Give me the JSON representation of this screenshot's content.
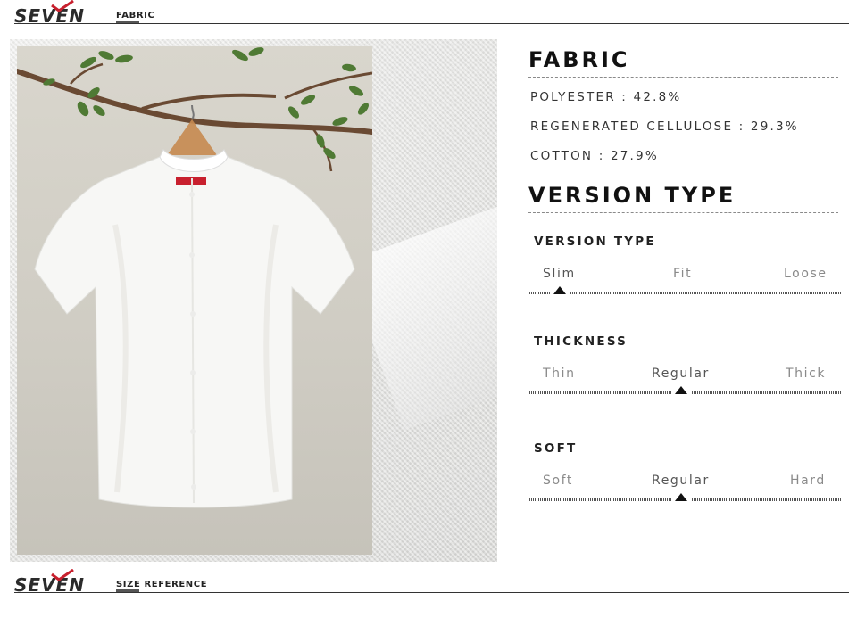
{
  "header": {
    "brand": "SEVEN",
    "label": "FABRIC"
  },
  "footer": {
    "brand": "SEVEN",
    "label": "SIZE REFERENCE"
  },
  "colors": {
    "brand_accent": "#c8202e",
    "text": "#111111",
    "muted": "#8a8a8a"
  },
  "fabric": {
    "heading": "FABRIC",
    "composition": [
      {
        "text": "POLYESTER  : 42.8%"
      },
      {
        "text": "REGENERATED CELLULOSE : 29.3%"
      },
      {
        "text": "COTTON : 27.9%"
      }
    ]
  },
  "version": {
    "heading": "VERSION TYPE",
    "scales": [
      {
        "title": "VERSION TYPE",
        "options": [
          "Slim",
          "Fit",
          "Loose"
        ],
        "selected": "Slim"
      },
      {
        "title": "THICKNESS",
        "options": [
          "Thin",
          "Regular",
          "Thick"
        ],
        "selected": "Regular"
      },
      {
        "title": "SOFT",
        "options": [
          "Soft",
          "Regular",
          "Hard"
        ],
        "selected": "Regular"
      }
    ]
  }
}
